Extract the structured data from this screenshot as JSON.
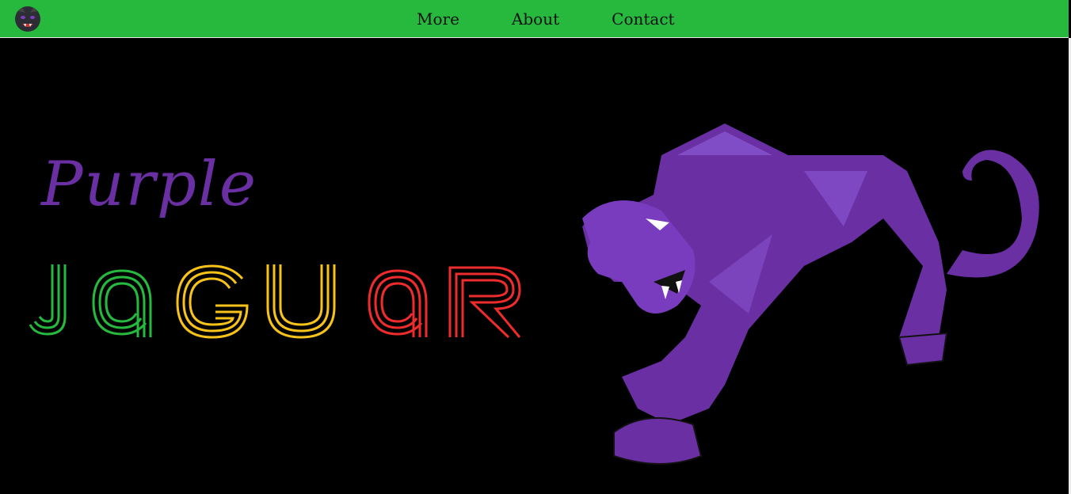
{
  "nav": {
    "links": [
      "More",
      "About",
      "Contact"
    ]
  },
  "hero": {
    "title_top": "Purple",
    "title_bottom_letters": [
      "J",
      "a",
      "G",
      "U",
      "a",
      "R"
    ]
  },
  "colors": {
    "nav_bg": "#26b93e",
    "purple": "#6a2fa3",
    "green": "#26b93e",
    "yellow": "#f7c21a",
    "red": "#ee2c2c"
  },
  "icons": [
    "panther-logo-icon",
    "jaguar-illustration"
  ]
}
